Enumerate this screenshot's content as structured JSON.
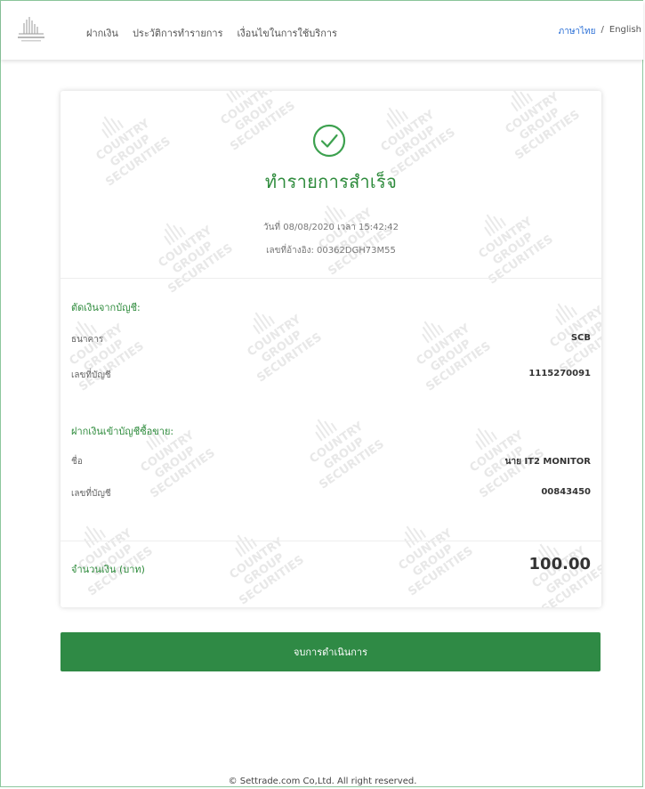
{
  "header": {
    "nav": [
      "ฝากเงิน",
      "ประวัติการทำรายการ",
      "เงื่อนไขในการใช้บริการ"
    ],
    "lang_thai": "ภาษาไทย",
    "lang_sep": "/",
    "lang_english": "English"
  },
  "receipt": {
    "title": "ทำรายการสำเร็จ",
    "date_line": "วันที่ 08/08/2020 เวลา 15:42:42",
    "ref_line": "เลขที่อ้างอิง: 00362DGH73M55",
    "from_section": "ตัดเงินจากบัญชี:",
    "from_rows": [
      {
        "label": "ธนาคาร",
        "value": "SCB"
      },
      {
        "label": "เลขที่บัญชี",
        "value": "1115270091"
      }
    ],
    "to_section": "ฝากเงินเข้าบัญชีซื้อขาย:",
    "to_rows": [
      {
        "label": "ชื่อ",
        "value": "นาย IT2 MONITOR"
      },
      {
        "label": "เลขที่บัญชี",
        "value": "00843450"
      }
    ],
    "amount_label": "จำนวนเงิน (บาท)",
    "amount_value": "100.00",
    "watermark_line1": "COUNTRY GROUP",
    "watermark_line2": "SECURITIES"
  },
  "actions": {
    "done_label": "จบการดำเนินการ"
  },
  "footer": {
    "copyright": "© Settrade.com Co,Ltd. All right reserved."
  },
  "colors": {
    "accent": "#2e8b3c",
    "button": "#2f8a45",
    "lang_active": "#2a6fd6"
  },
  "icons": {
    "success": "check-circle-icon",
    "logo": "country-group-logo"
  }
}
